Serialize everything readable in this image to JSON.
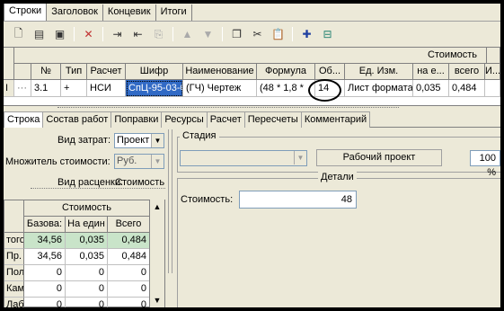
{
  "top_tabs": [
    "Строки",
    "Заголовок",
    "Концевик",
    "Итоги"
  ],
  "grid": {
    "group_header": "Стоимость",
    "columns": [
      "№",
      "Тип",
      "Расчет",
      "Шифр",
      "Наименование",
      "Формула",
      "Об...",
      "Ед. Изм.",
      "на е...",
      "всего",
      "И..."
    ],
    "row": {
      "marker": "I",
      "num": "3.1",
      "type": "+",
      "calc": "НСИ",
      "code": "СпЦ-95-03-0",
      "name": "(ГЧ) Чертеж",
      "formula": "(48 * 1,8 *",
      "volume": "14",
      "unit": "Лист формата",
      "unit_cost": "0,035",
      "total": "0,484"
    }
  },
  "bottom_tabs": [
    "Строка",
    "Состав работ",
    "Поправки",
    "Ресурсы",
    "Расчет",
    "Пересчеты",
    "Комментарий"
  ],
  "form": {
    "cost_type_label": "Вид затрат:",
    "cost_type_value": "Проект",
    "multiplier_label": "Множитель стоимости:",
    "multiplier_value": "Руб.",
    "pricing_label": "Вид расценки:",
    "pricing_value": "Стоимость"
  },
  "left_table": {
    "header": "Стоимость",
    "columns": [
      "Базова:",
      "На един",
      "Всего"
    ],
    "rows": [
      {
        "label": "того",
        "values": [
          "34,56",
          "0,035",
          "0,484"
        ]
      },
      {
        "label": "Пр.",
        "values": [
          "34,56",
          "0,035",
          "0,484"
        ]
      },
      {
        "label": "Пол.",
        "values": [
          "0",
          "0",
          "0"
        ]
      },
      {
        "label": "Кам.",
        "values": [
          "0",
          "0",
          "0"
        ]
      },
      {
        "label": "Лаб.",
        "values": [
          "0",
          "0",
          "0"
        ]
      }
    ]
  },
  "stage": {
    "legend": "Стадия",
    "button": "Рабочий проект",
    "percent": "100 %"
  },
  "details": {
    "legend": "Детали",
    "cost_label": "Стоимость:",
    "cost_value": "48"
  },
  "colors": {
    "selection": "#316ac5",
    "highlight_row": "#c9e4c9",
    "panel": "#ece9d8"
  }
}
